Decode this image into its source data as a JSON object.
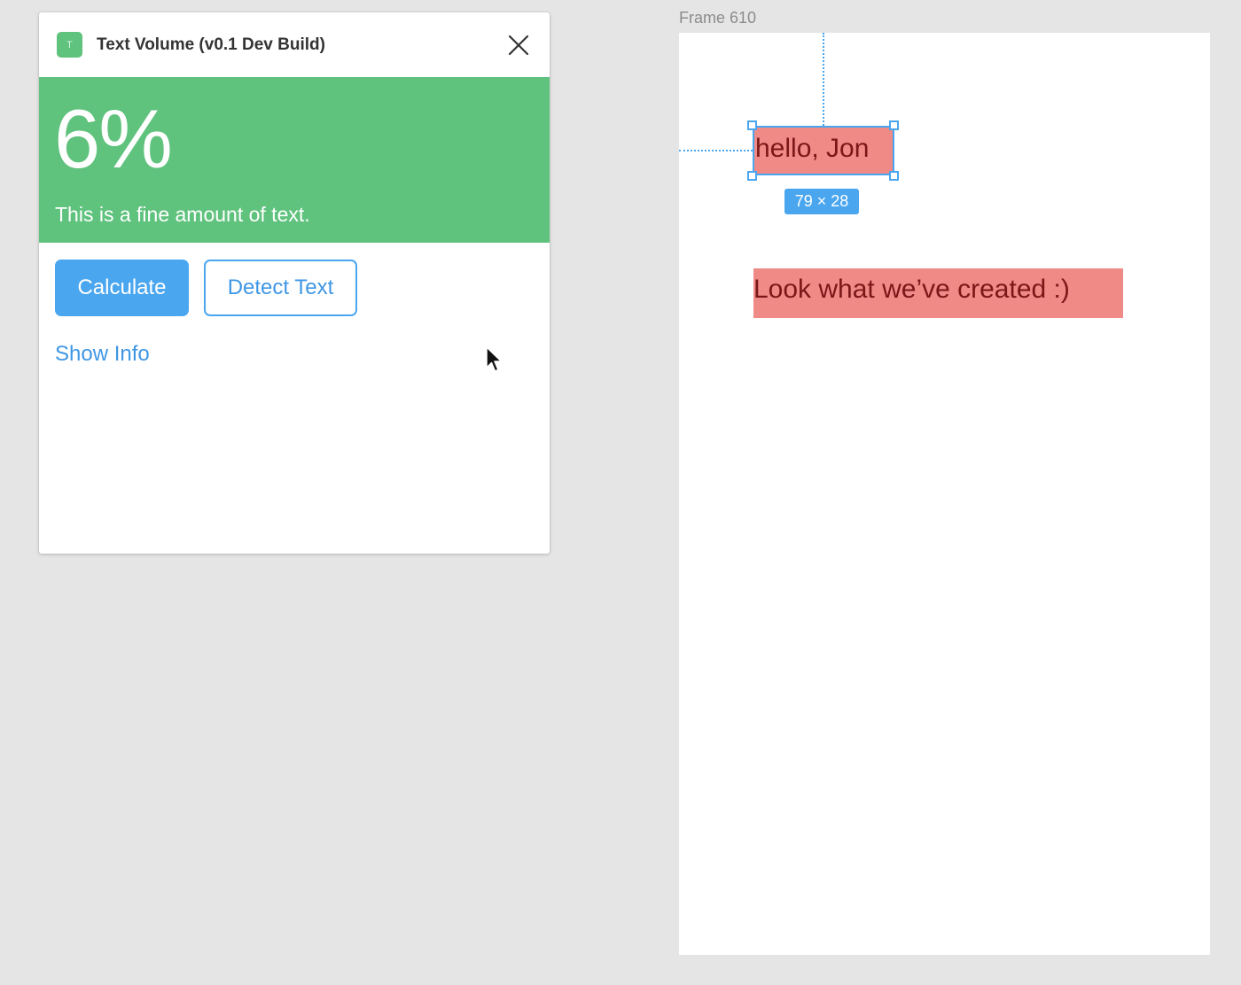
{
  "plugin": {
    "icon_letter": "T",
    "title": "Text Volume (v0.1 Dev Build)",
    "result": {
      "percent": "6%",
      "message": "This is a fine amount of text.",
      "color": "#5fc27d"
    },
    "buttons": {
      "calculate_label": "Calculate",
      "detect_label": "Detect Text"
    },
    "show_info_label": "Show Info"
  },
  "canvas": {
    "frame_label": "Frame 610",
    "layers": [
      {
        "text": "hello, Jon",
        "selected": true
      },
      {
        "text": "Look what we’ve created :)",
        "selected": false
      }
    ],
    "selection_size_label": "79 × 28"
  },
  "colors": {
    "accent": "#4aa6ef",
    "layer_fill": "#ef8a87",
    "layer_text": "#7a1717",
    "canvas_bg": "#e5e5e5"
  }
}
